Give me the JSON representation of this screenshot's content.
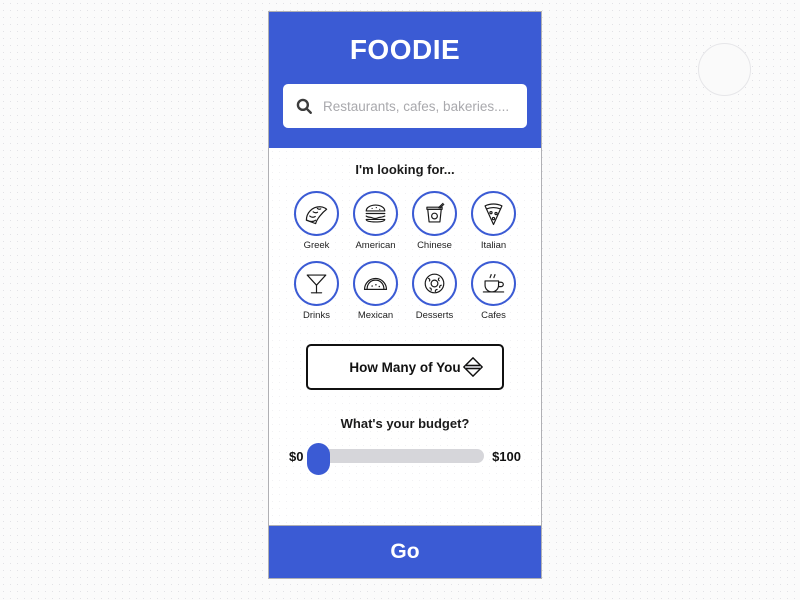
{
  "app": {
    "title": "FOODIE",
    "accent_color": "#3b5bd4",
    "frame_border_color": "#b0b0b4"
  },
  "search": {
    "placeholder": "Restaurants, cafes, bakeries....",
    "value": "",
    "icon": "search-icon"
  },
  "categories": {
    "heading": "I'm looking for...",
    "items": [
      {
        "label": "Greek",
        "icon": "taco-icon"
      },
      {
        "label": "American",
        "icon": "burger-icon"
      },
      {
        "label": "Chinese",
        "icon": "takeout-box-icon"
      },
      {
        "label": "Italian",
        "icon": "pizza-slice-icon"
      },
      {
        "label": "Drinks",
        "icon": "cocktail-glass-icon"
      },
      {
        "label": "Mexican",
        "icon": "empanada-icon"
      },
      {
        "label": "Desserts",
        "icon": "donut-icon"
      },
      {
        "label": "Cafes",
        "icon": "coffee-cup-icon"
      }
    ]
  },
  "party_size": {
    "label": "How Many of You",
    "value": "",
    "spinner_icon": "up-down-spinner-icon"
  },
  "budget": {
    "heading": "What's your budget?",
    "min_label": "$0",
    "max_label": "$100",
    "min": 0,
    "max": 100,
    "value": 0
  },
  "footer": {
    "go_label": "Go"
  }
}
